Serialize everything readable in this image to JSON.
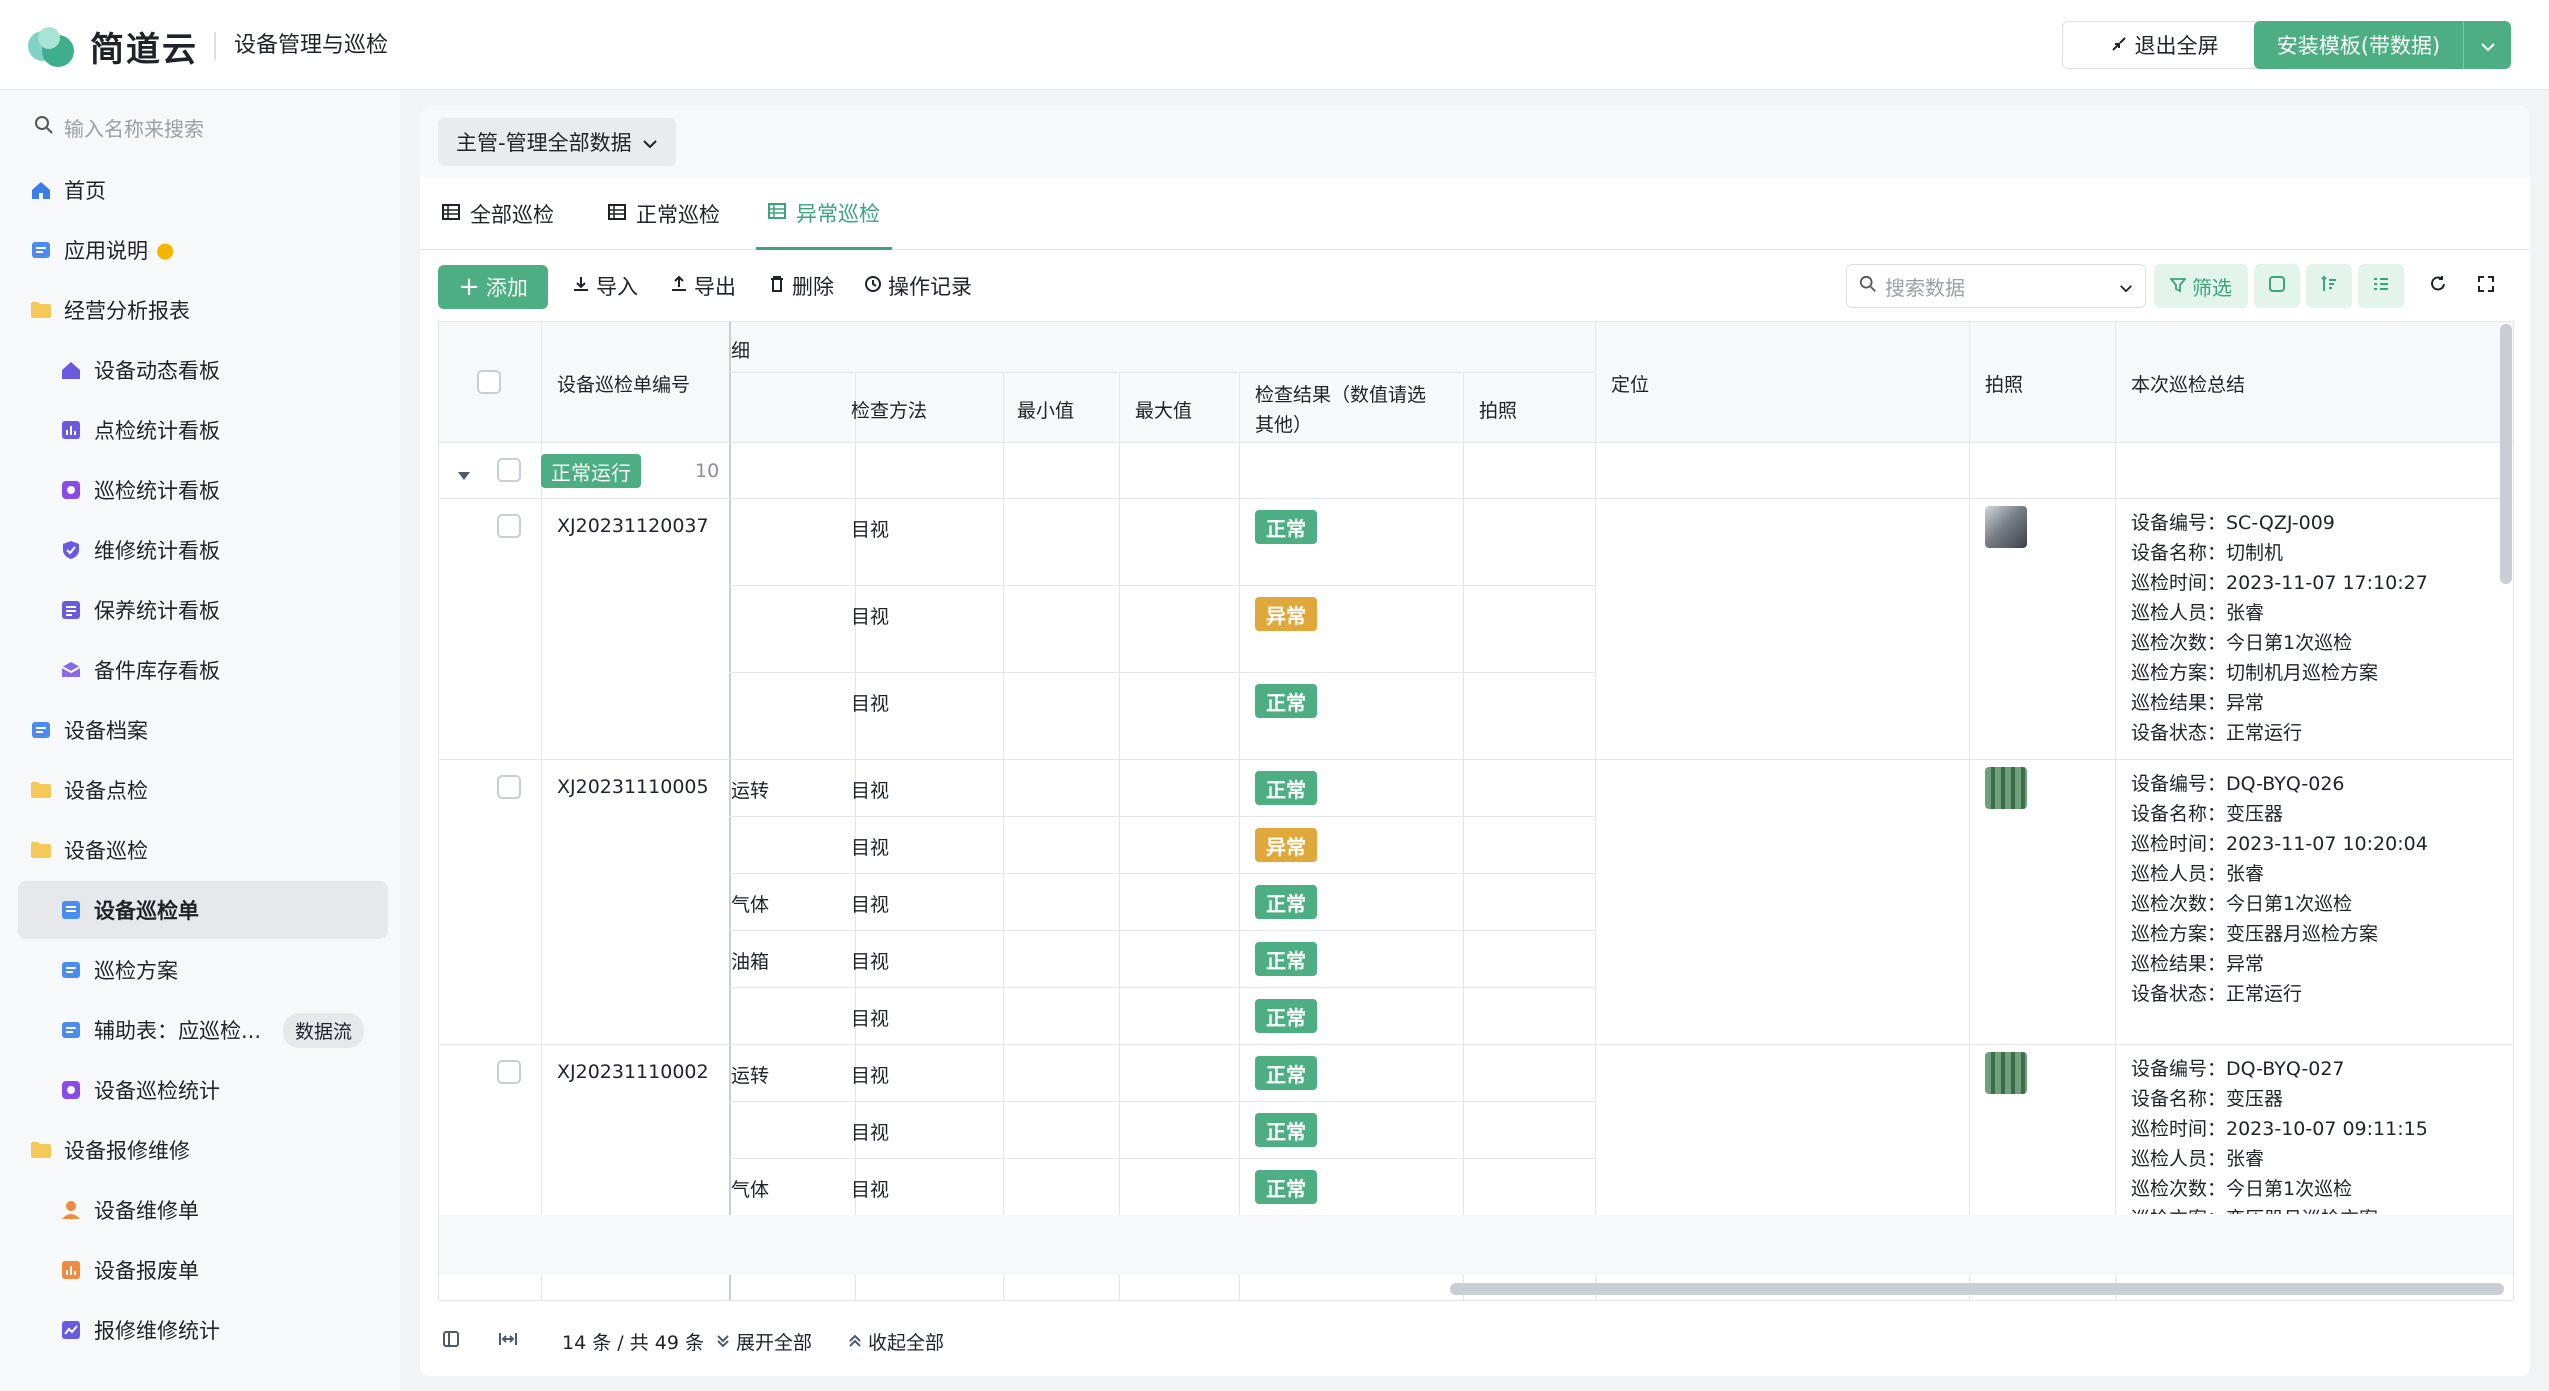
{
  "brand": {
    "logo_text": "简道云",
    "app_title": "设备管理与巡检",
    "accent": "#4cae82"
  },
  "topbar": {
    "exit_label": "退出全屏",
    "install_label": "安装模板(带数据)"
  },
  "sidebar": {
    "search_placeholder": "输入名称来搜索",
    "items": [
      {
        "label": "首页",
        "icon": "home-icon"
      },
      {
        "label": "应用说明",
        "icon": "doc-icon"
      },
      {
        "label": "经营分析报表",
        "icon": "folder-icon"
      },
      {
        "label": "设备动态看板",
        "icon": "home-icon"
      },
      {
        "label": "点检统计看板",
        "icon": "chart-icon"
      },
      {
        "label": "巡检统计看板",
        "icon": "report-icon"
      },
      {
        "label": "维修统计看板",
        "icon": "shield-icon"
      },
      {
        "label": "保养统计看板",
        "icon": "form-icon"
      },
      {
        "label": "备件库存看板",
        "icon": "inbox-icon"
      },
      {
        "label": "设备档案",
        "icon": "doc-icon"
      },
      {
        "label": "设备点检",
        "icon": "folder-icon"
      },
      {
        "label": "设备巡检",
        "icon": "folder-icon"
      },
      {
        "label": "设备巡检单",
        "icon": "form-icon"
      },
      {
        "label": "巡检方案",
        "icon": "doc-icon"
      },
      {
        "label": "辅助表：应巡检...",
        "icon": "doc-icon",
        "badge": "数据流"
      },
      {
        "label": "设备巡检统计",
        "icon": "report-icon"
      },
      {
        "label": "设备报修维修",
        "icon": "folder-icon"
      },
      {
        "label": "设备维修单",
        "icon": "user-icon"
      },
      {
        "label": "设备报废单",
        "icon": "chart-icon"
      },
      {
        "label": "报修维修统计",
        "icon": "trend-icon"
      }
    ]
  },
  "main": {
    "filter_label": "主管-管理全部数据",
    "tabs": [
      {
        "label": "全部巡检"
      },
      {
        "label": "正常巡检"
      },
      {
        "label": "异常巡检"
      }
    ],
    "toolbar": {
      "add": "添加",
      "import": "导入",
      "export": "导出",
      "delete": "删除",
      "history": "操作记录",
      "search_placeholder": "搜索数据",
      "filter": "筛选"
    }
  },
  "table": {
    "headers": {
      "id": "设备巡检单编号",
      "group_partial": "细",
      "method": "检查方法",
      "min": "最小值",
      "max": "最大值",
      "result_line1": "检查结果（数值请选",
      "result_line2": "其他）",
      "photo_sub": "拍照",
      "location": "定位",
      "photo": "拍照",
      "summary": "本次巡检总结"
    },
    "group": {
      "label": "正常运行",
      "count": "10"
    },
    "records": [
      {
        "id": "XJ20231120037",
        "rows": [
          {
            "item": "",
            "method": "目视",
            "result": "正常"
          },
          {
            "item": "",
            "method": "目视",
            "result": "异常"
          },
          {
            "item": "",
            "method": "目视",
            "result": "正常"
          }
        ],
        "summary": [
          "设备编号：SC-QZJ-009",
          "设备名称：切制机",
          "巡检时间：2023-11-07 17:10:27",
          "巡检人员：张睿",
          "巡检次数：今日第1次巡检",
          "巡检方案：切制机月巡检方案",
          "巡检结果：异常",
          "设备状态：正常运行"
        ]
      },
      {
        "id": "XJ20231110005",
        "rows": [
          {
            "item": "运转",
            "method": "目视",
            "result": "正常"
          },
          {
            "item": "",
            "method": "目视",
            "result": "异常"
          },
          {
            "item": "气体",
            "method": "目视",
            "result": "正常"
          },
          {
            "item": "油箱",
            "method": "目视",
            "result": "正常"
          },
          {
            "item": "",
            "method": "目视",
            "result": "正常"
          }
        ],
        "summary": [
          "设备编号：DQ-BYQ-026",
          "设备名称：变压器",
          "巡检时间：2023-11-07 10:20:04",
          "巡检人员：张睿",
          "巡检次数：今日第1次巡检",
          "巡检方案：变压器月巡检方案",
          "巡检结果：异常",
          "设备状态：正常运行"
        ]
      },
      {
        "id": "XJ20231110002",
        "rows": [
          {
            "item": "运转",
            "method": "目视",
            "result": "正常"
          },
          {
            "item": "",
            "method": "目视",
            "result": "正常"
          },
          {
            "item": "气体",
            "method": "目视",
            "result": "正常"
          }
        ],
        "summary": [
          "设备编号：DQ-BYQ-027",
          "设备名称：变压器",
          "巡检时间：2023-10-07 09:11:15",
          "巡检人员：张睿",
          "巡检次数：今日第1次巡检",
          "巡检方案：变压器月巡检方案"
        ]
      }
    ]
  },
  "footer": {
    "count": "14 条 / 共 49 条",
    "expand": "展开全部",
    "collapse": "收起全部"
  }
}
